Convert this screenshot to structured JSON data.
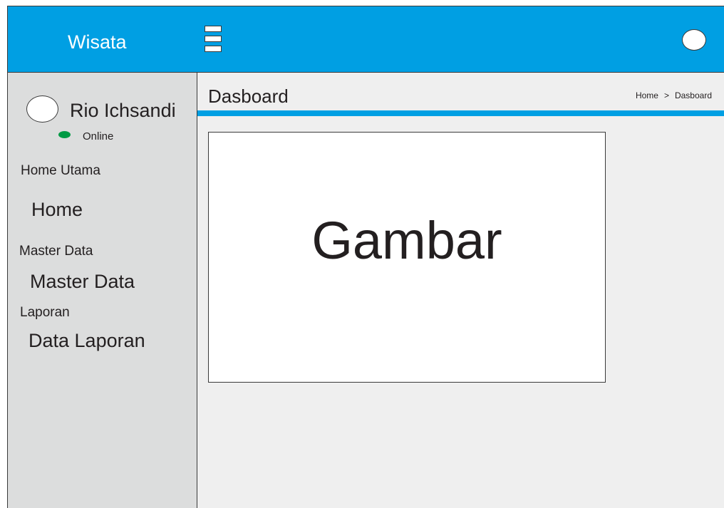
{
  "header": {
    "brand": "Wisata",
    "menu_icon": "hamburger-icon",
    "user_icon": "user-avatar-icon"
  },
  "sidebar": {
    "user": {
      "name": "Rio Ichsandi",
      "status": "Online",
      "status_color": "#009a44"
    },
    "sections": [
      {
        "label": "Home Utama",
        "items": [
          {
            "label": "Home"
          }
        ]
      },
      {
        "label": "Master Data",
        "items": [
          {
            "label": "Master Data"
          }
        ]
      },
      {
        "label": "Laporan",
        "items": [
          {
            "label": "Data Laporan"
          }
        ]
      }
    ]
  },
  "main": {
    "title": "Dasboard",
    "breadcrumb": [
      "Home",
      ">",
      "Dasboard"
    ],
    "image_placeholder": "Gambar"
  },
  "colors": {
    "accent": "#009fe3",
    "sidebar_bg": "#dcdddd",
    "content_bg": "#efefef"
  }
}
